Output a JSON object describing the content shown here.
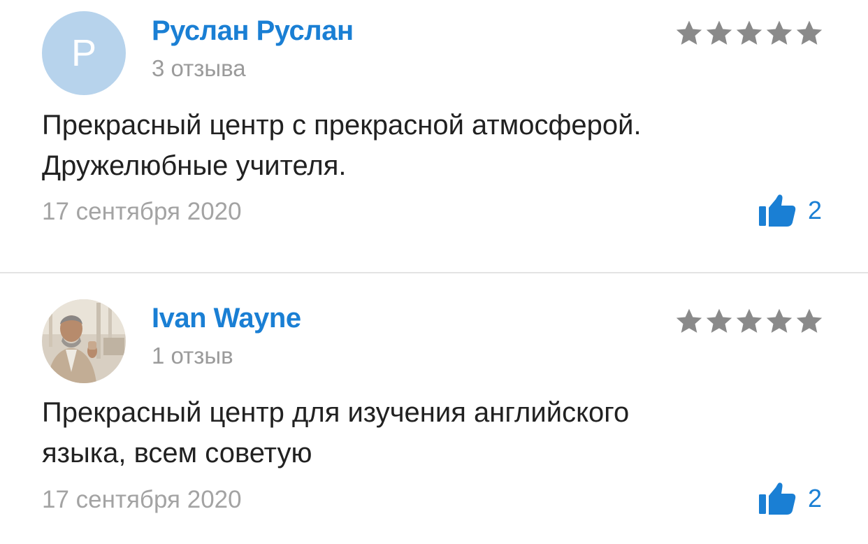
{
  "colors": {
    "accent": "#1a7fd4",
    "star": "#8a8a8a",
    "muted_text": "#9b9b9b",
    "body_text": "#212121",
    "avatar_bg": "#b7d3ec"
  },
  "reviews": [
    {
      "author": "Руслан Руслан",
      "review_count": "3 отзыва",
      "avatar_letter": "Р",
      "avatar_type": "letter",
      "rating": 5,
      "rating_icon": "star-icon",
      "text_lines": [
        "Прекрасный центр с прекрасной атмосферой.",
        "Дружелюбные учителя."
      ],
      "date": "17 сентября 2020",
      "like_icon": "thumbs-up-icon",
      "likes": "2"
    },
    {
      "author": "Ivan Wayne",
      "review_count": "1 отзыв",
      "avatar_type": "photo",
      "rating": 5,
      "rating_icon": "star-icon",
      "text_lines": [
        "Прекрасный центр для изучения английского",
        "языка, всем советую"
      ],
      "date": "17 сентября 2020",
      "like_icon": "thumbs-up-icon",
      "likes": "2"
    }
  ]
}
